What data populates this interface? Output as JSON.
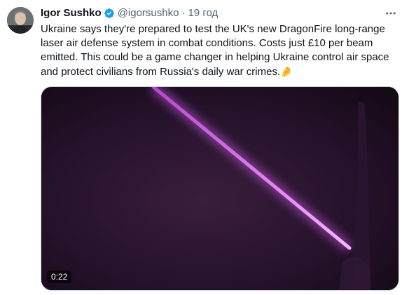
{
  "tweet": {
    "author_name": "Igor Sushko",
    "handle": "@igorsushko",
    "separator": "·",
    "time": "19 год",
    "text": "Ukraine says they're prepared to test the UK's new DragonFire long-range laser air defense system in combat conditions. Costs just £10 per beam emitted. This could be a game changer in helping Ukraine control air space and protect civilians from Russia's daily war crimes.",
    "emoji": "🤌",
    "more_icon": "ellipsis-icon",
    "verified_icon": "verified-badge-icon"
  },
  "media": {
    "duration": "0:22",
    "beam_color": "#e070f0",
    "background_color": "#1e0c20"
  },
  "colors": {
    "text": "#0f1419",
    "muted": "#536471",
    "verified": "#1d9bf0"
  }
}
